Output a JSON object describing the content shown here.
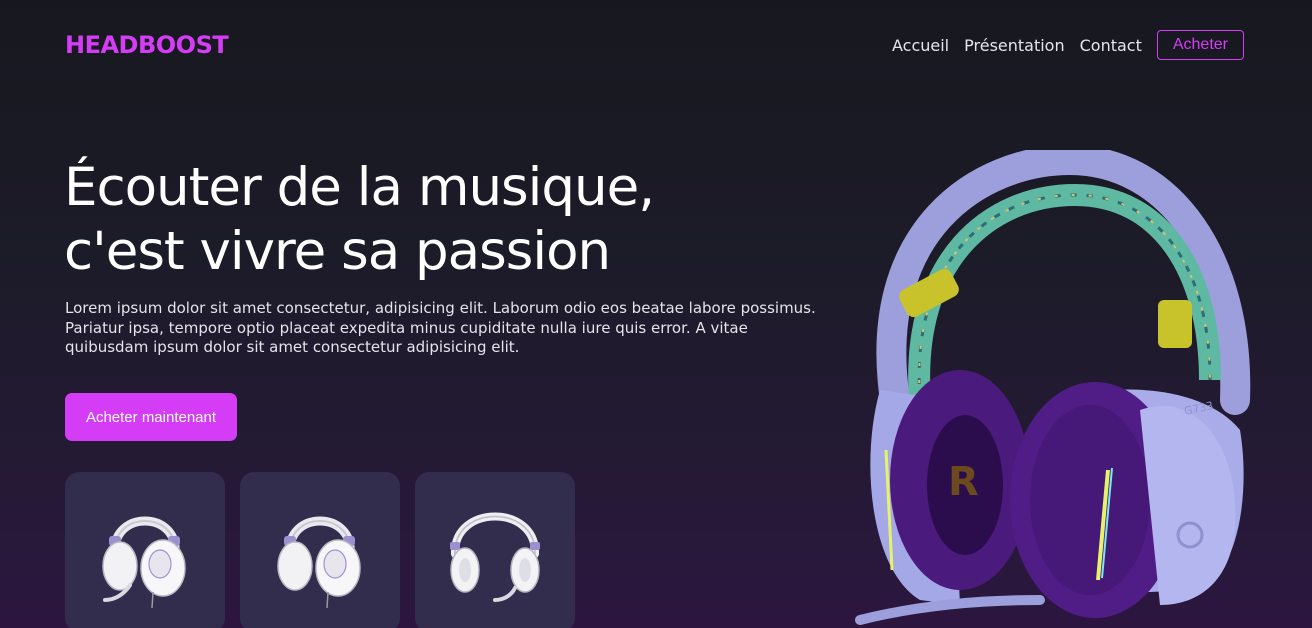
{
  "brand": {
    "logo": "HEADBOOST",
    "accent": "#d43df5"
  },
  "nav": {
    "links": [
      "Accueil",
      "Présentation",
      "Contact"
    ],
    "buy_label": "Acheter"
  },
  "hero": {
    "title_line1": "Écouter de la musique,",
    "title_line2": "c'est vivre sa passion",
    "description": "Lorem ipsum dolor sit amet consectetur, adipisicing elit. Laborum odio eos beatae labore possimus. Pariatur ipsa, tempore optio placeat expedita minus cupiditate nulla iure quis error. A vitae quibusdam ipsum dolor sit amet consectetur adipisicing elit.",
    "cta_label": "Acheter maintenant",
    "product_model": "G733"
  },
  "thumbnails": [
    {
      "icon": "white-headset-front-icon"
    },
    {
      "icon": "white-headset-front-icon"
    },
    {
      "icon": "white-headset-open-icon"
    }
  ]
}
